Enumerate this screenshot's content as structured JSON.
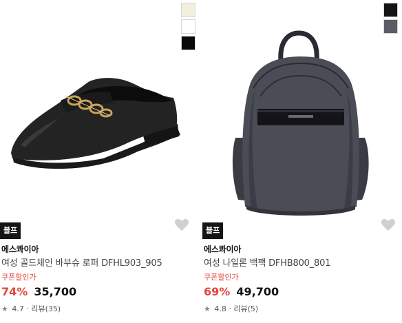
{
  "products": [
    {
      "badge": "블프",
      "brand": "에스콰이아",
      "name": "여성 골드체인 바부슈 로퍼 DFHL903_905",
      "coupon": "쿠폰할인가",
      "discount": "74%",
      "price": "35,700",
      "rating_value": "4.7",
      "reviews": "리뷰(35)",
      "swatches": [
        "#f3eedd",
        "#ffffff",
        "#0a0a0a"
      ],
      "image_icon": "black-loafer-image"
    },
    {
      "badge": "블프",
      "brand": "에스콰이아",
      "name": "여성 나일론 백팩 DFHB800_801",
      "coupon": "쿠폰할인가",
      "discount": "69%",
      "price": "49,700",
      "rating_value": "4.8",
      "reviews": "리뷰(5)",
      "swatches": [
        "#141414",
        "#5a5c66"
      ],
      "image_icon": "nylon-backpack-image"
    }
  ],
  "rating_separator": "·",
  "colors": {
    "discount": "#e0473c",
    "badge_bg": "#151515",
    "heart": "#d0d0d0"
  },
  "icons": {
    "wishlist": "heart-icon",
    "rating": "star-icon"
  }
}
